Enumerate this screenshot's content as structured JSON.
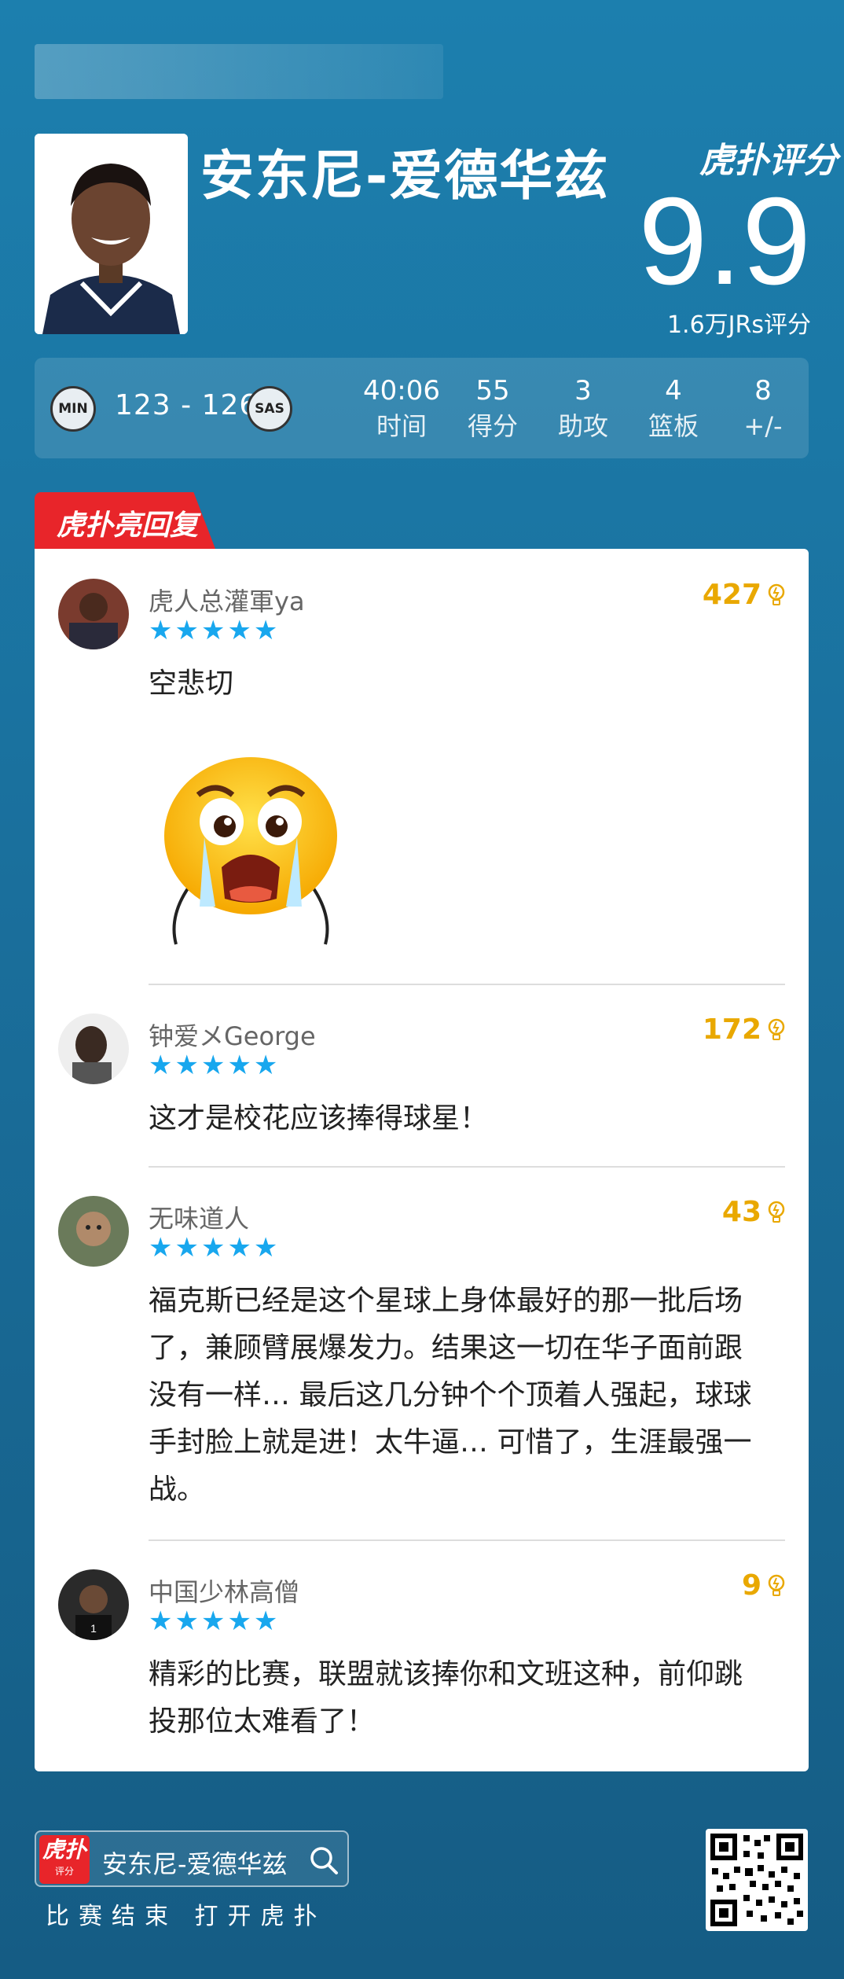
{
  "header": {
    "player_name": "安东尼-爱德华兹",
    "brand": "虎扑评分",
    "score": "9.9",
    "rating_count": "1.6万JRs评分"
  },
  "stats": {
    "home_team": "MIN",
    "away_team": "SAS",
    "game_score": "123 - 126",
    "items": [
      {
        "value": "40:06",
        "label": "时间"
      },
      {
        "value": "55",
        "label": "得分"
      },
      {
        "value": "3",
        "label": "助攻"
      },
      {
        "value": "4",
        "label": "篮板"
      },
      {
        "value": "8",
        "label": "+/-"
      }
    ]
  },
  "section_tag": "虎扑亮回复",
  "comments": [
    {
      "user": "虎人总灌軍ya",
      "stars": "★★★★★",
      "likes": "427",
      "text": "空悲切"
    },
    {
      "user": "钟爱メGeorge",
      "stars": "★★★★★",
      "likes": "172",
      "text": "这才是校花应该捧得球星！"
    },
    {
      "user": "无味道人",
      "stars": "★★★★★",
      "likes": "43",
      "text": "福克斯已经是这个星球上身体最好的那一批后场了，兼顾臂展爆发力。结果这一切在华子面前跟没有一样… 最后这几分钟个个顶着人强起，球球手封脸上就是进！太牛逼… 可惜了，生涯最强一战。"
    },
    {
      "user": "中国少林高僧",
      "stars": "★★★★★",
      "likes": "9",
      "text": "精彩的比赛，联盟就该捧你和文班这种，前仰跳投那位太难看了！"
    }
  ],
  "footer": {
    "app_icon_top": "虎扑",
    "app_icon_bottom": "评分",
    "search_text": "安东尼-爱德华兹",
    "cta": "比赛结束 打开虎扑"
  },
  "colors": {
    "accent_red": "#e8252a",
    "star_blue": "#18a7ee",
    "likes_gold": "#e9a800"
  }
}
